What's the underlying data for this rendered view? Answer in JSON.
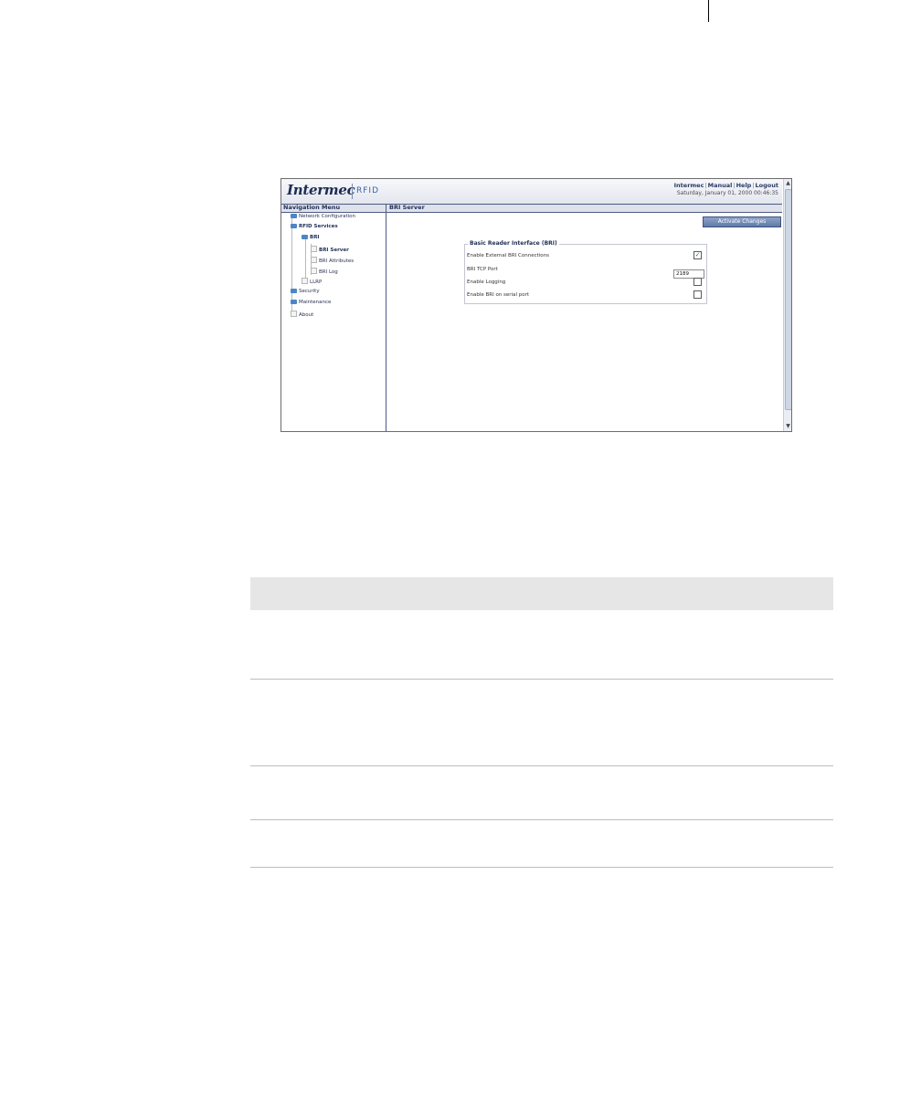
{
  "header": {
    "logo_text": "Intermec",
    "logo_sub": "RFID",
    "links": [
      "Intermec",
      "Manual",
      "Help",
      "Logout"
    ],
    "datetime": "Saturday, January 01, 2000 00:46:35"
  },
  "titlebar": {
    "nav_title": "Navigation Menu",
    "page_title": "BRI Server"
  },
  "nav": {
    "items": [
      "Network Configuration",
      "RFID Services",
      "BRI",
      "BRI Server",
      "BRI Attributes",
      "BRI Log",
      "LLRP",
      "Security",
      "Maintenance",
      "About"
    ]
  },
  "main": {
    "activate_label": "Activate Changes",
    "fieldset_legend": "Basic Reader Interface (BRI)",
    "rows": [
      {
        "label": "Enable External BRI Connections",
        "checked": true
      },
      {
        "label": "BRI TCP Port",
        "value": "2189"
      },
      {
        "label": "Enable Logging",
        "checked": false
      },
      {
        "label": "Enable BRI on serial port",
        "checked": false
      }
    ]
  },
  "icons": {
    "checkmark": "✓",
    "scroll_up": "▲",
    "scroll_down": "▼"
  }
}
